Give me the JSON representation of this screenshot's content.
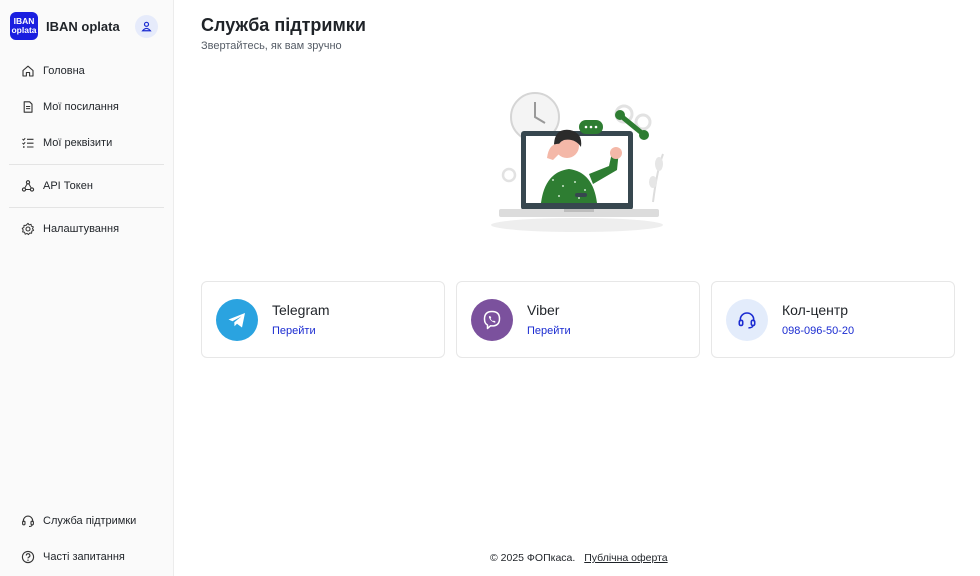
{
  "brand": {
    "logo_line1": "IBAN",
    "logo_line2": "oplata",
    "name": "IBAN oplata"
  },
  "sidebar": {
    "items": [
      {
        "label": "Головна",
        "icon": "home-icon"
      },
      {
        "label": "Мої посилання",
        "icon": "document-icon"
      },
      {
        "label": "Мої реквізити",
        "icon": "checklist-icon"
      },
      {
        "label": "API Токен",
        "icon": "api-icon"
      },
      {
        "label": "Налаштування",
        "icon": "gear-icon"
      }
    ],
    "bottom_items": [
      {
        "label": "Служба підтримки",
        "icon": "headset-icon"
      },
      {
        "label": "Часті запитання",
        "icon": "question-icon"
      }
    ]
  },
  "main": {
    "title": "Служба підтримки",
    "subtitle": "Звертайтесь, як вам зручно"
  },
  "cards": [
    {
      "title": "Telegram",
      "link": "Перейти",
      "icon": "telegram-icon",
      "color": "#2aa3e0"
    },
    {
      "title": "Viber",
      "link": "Перейти",
      "icon": "viber-icon",
      "color": "#7b519d"
    },
    {
      "title": "Кол-центр",
      "link": "098-096-50-20",
      "icon": "headset-icon",
      "color": "#e3ecfb"
    }
  ],
  "footer": {
    "copyright": "© 2025 ФОПкаса.",
    "offer": "Публічна оферта"
  },
  "colors": {
    "accent": "#1a1fe0",
    "link": "#1a2bd1",
    "illustration_green": "#2e7d32"
  }
}
